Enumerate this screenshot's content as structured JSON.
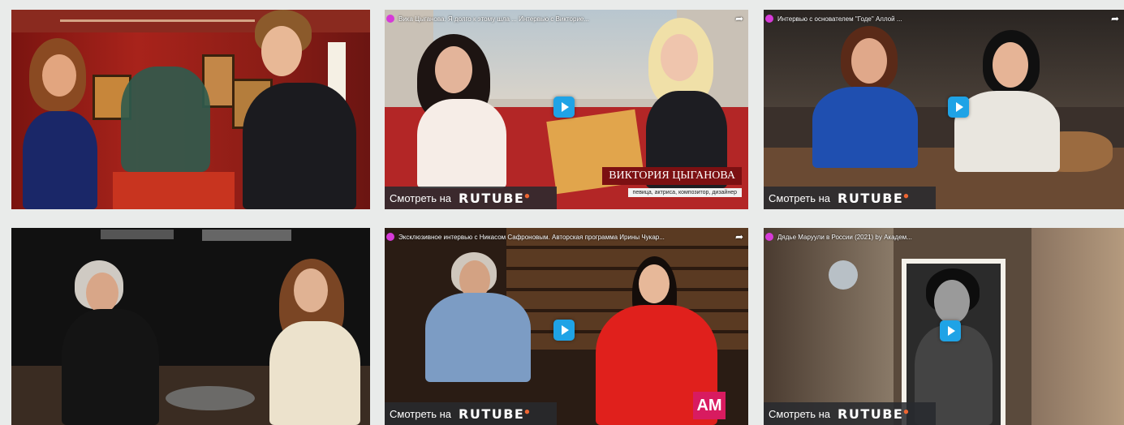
{
  "colors": {
    "page_background": "#e9ebea",
    "play_button": "#1fa3e6",
    "channel_dot": "#d63ad8",
    "watch_bar": "#2a2c30"
  },
  "watch_label": "Смотреть на",
  "brand": "RUTUBE",
  "tiles": [
    {
      "kind": "image",
      "description_icon": "gallery-scene-image"
    },
    {
      "kind": "video",
      "title": "Вика Цыганова. Я долго к этому шла ... Интервью с Викторие...",
      "caption_name": "ВИКТОРИЯ ЦЫГАНОВА",
      "caption_sub": "певица, актриса, композитор, дизайнер"
    },
    {
      "kind": "video",
      "title": "Интервью с основателем \"Годе\" Аллой ..."
    },
    {
      "kind": "image",
      "description_icon": "studio-interview-image"
    },
    {
      "kind": "video",
      "title": "Эксклюзивное интервью с Никасом Сафроновым. Авторская программа Ирины Чукар...",
      "badge": "AM"
    },
    {
      "kind": "video",
      "title": "Дядье Маруули в России (2021) by Академ..."
    }
  ]
}
